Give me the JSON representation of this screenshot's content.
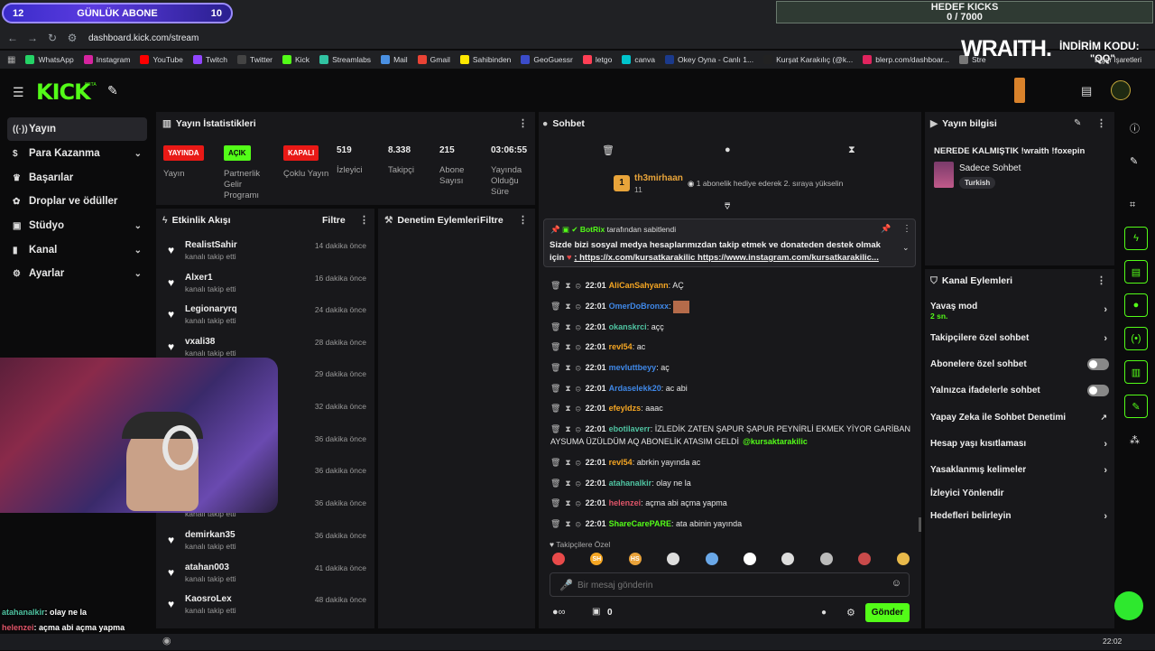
{
  "overlay": {
    "abone_left": "12",
    "abone_title": "GÜNLÜK ABONE",
    "abone_right": "10",
    "hedef_title": "HEDEF KICKS",
    "hedef_value": "0 / 7000",
    "wraith": "WRAITH.",
    "indirim": "İNDİRİM KODU:",
    "qq": "\"QQ\""
  },
  "browser": {
    "url": "dashboard.kick.com/stream",
    "bookmarks": [
      {
        "label": "WhatsApp",
        "color": "#25d366"
      },
      {
        "label": "Instagram",
        "color": "#d6249f"
      },
      {
        "label": "YouTube",
        "color": "#ff0000"
      },
      {
        "label": "Twitch",
        "color": "#9146ff"
      },
      {
        "label": "Twitter",
        "color": "#444444"
      },
      {
        "label": "Kick",
        "color": "#53fc18"
      },
      {
        "label": "Streamlabs",
        "color": "#31c3a2"
      },
      {
        "label": "Mail",
        "color": "#4a90e2"
      },
      {
        "label": "Gmail",
        "color": "#ea4335"
      },
      {
        "label": "Sahibinden",
        "color": "#ffe800"
      },
      {
        "label": "GeoGuessr",
        "color": "#3b4cca"
      },
      {
        "label": "letgo",
        "color": "#ff3f55"
      },
      {
        "label": "canva",
        "color": "#00c4cc"
      },
      {
        "label": "Okey Oyna - Canlı 1...",
        "color": "#1b3a8c"
      },
      {
        "label": "Kurşat Karakılıç (@k...",
        "color": "#222222"
      },
      {
        "label": "blerp.com/dashboar...",
        "color": "#e0245e"
      },
      {
        "label": "Stre",
        "color": "#777777"
      }
    ],
    "other": "Diğer İşaretleri"
  },
  "kick": {
    "logo": "KICK",
    "beta": "BETA"
  },
  "sidebar": {
    "items": [
      {
        "label": "Yayın",
        "icon": "broadcast-icon",
        "active": true,
        "chev": false
      },
      {
        "label": "Para Kazanma",
        "icon": "money-icon",
        "chev": true
      },
      {
        "label": "Başarılar",
        "icon": "trophy-icon",
        "chev": false
      },
      {
        "label": "Droplar ve ödüller",
        "icon": "gift-icon",
        "chev": false
      },
      {
        "label": "Stüdyo",
        "icon": "studio-icon",
        "chev": true
      },
      {
        "label": "Kanal",
        "icon": "channel-icon",
        "chev": true
      },
      {
        "label": "Ayarlar",
        "icon": "gear-icon",
        "chev": true
      }
    ]
  },
  "stats": {
    "title": "Yayın İstatistikleri",
    "badges": [
      {
        "label": "YAYINDA",
        "desc": "Yayın",
        "color": "#e91916"
      },
      {
        "label": "AÇIK",
        "desc": "Partnerlik Gelir Programı",
        "color": "#53fc18"
      },
      {
        "label": "KAPALI",
        "desc": "Çoklu Yayın",
        "color": "#e91916"
      }
    ],
    "values": [
      {
        "value": "519",
        "label": "İzleyici"
      },
      {
        "value": "8.338",
        "label": "Takipçi"
      },
      {
        "value": "215",
        "label": "Abone Sayısı"
      },
      {
        "value": "03:06:55",
        "label": "Yayında Olduğu Süre"
      }
    ]
  },
  "activity": {
    "title": "Etkinlik Akışı",
    "filter": "Filtre",
    "events": [
      {
        "name": "RealistSahir",
        "sub": "kanalı takip etti",
        "time": "14 dakika önce"
      },
      {
        "name": "Alxer1",
        "sub": "kanalı takip etti",
        "time": "16 dakika önce"
      },
      {
        "name": "Legionaryrq",
        "sub": "kanalı takip etti",
        "time": "24 dakika önce"
      },
      {
        "name": "vxali38",
        "sub": "kanalı takip etti",
        "time": "28 dakika önce"
      },
      {
        "name": "",
        "sub": "",
        "time": "29 dakika önce"
      },
      {
        "name": "",
        "sub": "",
        "time": "32 dakika önce"
      },
      {
        "name": "",
        "sub": "",
        "time": "36 dakika önce"
      },
      {
        "name": "",
        "sub": "",
        "time": "36 dakika önce"
      },
      {
        "name": "",
        "sub": "kanalı takip etti",
        "time": "36 dakika önce"
      },
      {
        "name": "demirkan35",
        "sub": "kanalı takip etti",
        "time": "36 dakika önce"
      },
      {
        "name": "atahan003",
        "sub": "kanalı takip etti",
        "time": "41 dakika önce"
      },
      {
        "name": "KaosroLex",
        "sub": "kanalı takip etti",
        "time": "48 dakika önce"
      }
    ]
  },
  "moderation": {
    "title": "Denetim Eylemleri",
    "filter": "Filtre"
  },
  "chat": {
    "title": "Sohbet",
    "top_user": "th3mirhaan",
    "top_count": "11",
    "top_msg": "1 abonelik hediye ederek 2. sıraya yükselin",
    "pinned_by": "BotRix",
    "pinned_suffix": "tarafından sabitlendi",
    "pinned_text": "Sizde bizi sosyal medya hesaplarımızdan takip etmek ve donateden destek olmak için",
    "pinned_links": "; https://x.com/kursatkarakilic https://www.instagram.com/kursatkarakilic...",
    "messages": [
      {
        "time": "22:01",
        "user": "AliCanSahyann",
        "color": "#f5a623",
        "text": "AÇ"
      },
      {
        "time": "22:01",
        "user": "OmerDoBronxx",
        "color": "#3f88e8",
        "text": ""
      },
      {
        "time": "22:01",
        "user": "okanskrci",
        "color": "#4fc3a1",
        "text": "açç"
      },
      {
        "time": "22:01",
        "user": "revl54",
        "color": "#f5a623",
        "text": "ac"
      },
      {
        "time": "22:01",
        "user": "mevluttbeyy",
        "color": "#3f88e8",
        "text": "aç"
      },
      {
        "time": "22:01",
        "user": "Ardaselekk20",
        "color": "#3f88e8",
        "text": "ac abi"
      },
      {
        "time": "22:01",
        "user": "efeyldzs",
        "color": "#f5a623",
        "text": "aaac"
      },
      {
        "time": "22:01",
        "user": "ebotilaverr",
        "color": "#4fc3a1",
        "text": "İZLEDİK ZATEN ŞAPUR ŞAPUR PEYNİRLİ EKMEK YİYOR GARİBAN AYSUMA ÜZÜLDÜM AQ ABONELİK ATASIM GELDİ",
        "mention": "@kursaktarakilic"
      },
      {
        "time": "22:01",
        "user": "revl54",
        "color": "#f5a623",
        "text": "abrkin yayında ac"
      },
      {
        "time": "22:01",
        "user": "atahanalkir",
        "color": "#4fc3a1",
        "text": "olay ne la"
      },
      {
        "time": "22:01",
        "user": "helenzei",
        "color": "#e05569",
        "text": "açma abi açma yapma"
      },
      {
        "time": "22:01",
        "user": "ShareCarePARE",
        "color": "#53fc18",
        "text": "ata abinin yayında"
      }
    ],
    "emote_label": "Takipçilere Özel",
    "emotes": [
      "#e84a4a",
      "#f5a623",
      "#e8a23a",
      "#dddddd",
      "#6aa8e8",
      "#ffffff",
      "#dddddd",
      "#bbbbbb",
      "#c94a4a",
      "#e8b94a"
    ],
    "emote_texts": [
      "",
      "SH",
      "HS",
      "",
      "",
      "",
      "",
      "",
      "",
      ""
    ],
    "placeholder": "Bir mesaj gönderin",
    "kicks": "0",
    "send": "Gönder"
  },
  "info": {
    "title": "Yayın bilgisi",
    "stream_title": "NEREDE KALMIŞTIK !wraith !foxepin",
    "category": "Sadece Sohbet",
    "tag": "Turkish"
  },
  "actions": {
    "title": "Kanal Eylemleri",
    "items": [
      {
        "label": "Yavaş mod",
        "sub": "2 sn.",
        "kind": "chev"
      },
      {
        "label": "Takipçilere özel sohbet",
        "kind": "chev"
      },
      {
        "label": "Abonelere özel sohbet",
        "kind": "toggle"
      },
      {
        "label": "Yalnızca ifadelerle sohbet",
        "kind": "toggle"
      },
      {
        "label": "Yapay Zeka ile Sohbet Denetimi",
        "kind": "ext"
      },
      {
        "label": "Hesap yaşı kısıtlaması",
        "kind": "chev"
      },
      {
        "label": "Yasaklanmış kelimeler",
        "kind": "chev"
      },
      {
        "label": "İzleyici Yönlendir",
        "kind": "none"
      },
      {
        "label": "Hedefleri belirleyin",
        "kind": "chev"
      }
    ]
  },
  "overlay_chat": [
    {
      "user": "atahanalkir",
      "color": "#4fc3a1",
      "text": ": olay ne la"
    },
    {
      "user": "helenzei",
      "color": "#e05569",
      "text": ": açma abi açma yapma"
    },
    {
      "user": "ShareCarePARE",
      "color": "#53fc18",
      "text": ": ata abinin yayında"
    }
  ],
  "taskbar": {
    "time": "22:02"
  }
}
